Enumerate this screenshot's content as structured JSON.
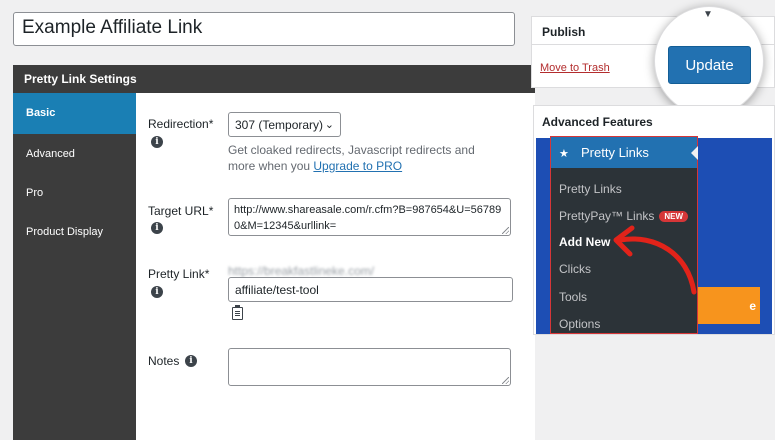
{
  "post_title": "Example Affiliate Link",
  "settings": {
    "header": "Pretty Link Settings",
    "tabs": [
      "Basic",
      "Advanced",
      "Pro",
      "Product Display"
    ],
    "active_tab": "Basic",
    "redirection_label": "Redirection",
    "redirection_value": "307 (Temporary)",
    "redirection_help": "Get cloaked redirects, Javascript redirects and more when you",
    "upgrade_link": "Upgrade to PRO",
    "target_url_label": "Target URL",
    "target_url_value": "http://www.shareasale.com/r.cfm?B=987654&U=567890&M=12345&urllink=",
    "pretty_link_label": "Pretty Link",
    "pretty_link_base": "https://breakfastlineke.com/",
    "pretty_link_slug": "affiliate/test-tool",
    "notes_label": "Notes",
    "required_mark": "*",
    "info_glyph": "i"
  },
  "publish": {
    "title": "Publish",
    "trash": "Move to Trash",
    "update": "Update"
  },
  "advanced": {
    "title": "Advanced Features",
    "menu_title": "Pretty Links",
    "items": [
      "Pretty Links",
      "PrettyPay™ Links",
      "Add New",
      "Clicks",
      "Tools",
      "Options"
    ],
    "new_badge": "NEW",
    "current_item": "Add New",
    "orange_button_fragment": "e"
  },
  "colors": {
    "accent": "#2271b1",
    "nav_dark": "#3c3c3c",
    "active_tab": "#1a7fb4",
    "menu_dark": "#2c3338",
    "highlight_red": "#d63638",
    "orange": "#f7941d",
    "banner_blue": "#1d4eb4"
  }
}
